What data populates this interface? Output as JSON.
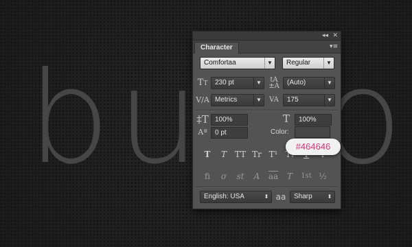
{
  "canvas": {
    "text": "button",
    "text_color": "#464646"
  },
  "panel": {
    "topbar": {
      "collapse_icon": "◂◂",
      "close_icon": "✕"
    },
    "tab_label": "Character",
    "menu_icon": "▾≡",
    "font_family": "Comfortaa",
    "font_style": "Regular",
    "font_size": "230 pt",
    "leading": "(Auto)",
    "kerning": "Metrics",
    "tracking": "175",
    "vertical_scale": "100%",
    "horizontal_scale": "100%",
    "baseline_shift": "0 pt",
    "color_label": "Color:",
    "color_value": "#464646",
    "style_buttons": [
      "T",
      "T",
      "TT",
      "Tr",
      "T¹",
      "T₁",
      "T",
      "T"
    ],
    "opentype_buttons": [
      "fi",
      "σ",
      "st",
      "A",
      "aa",
      "T",
      "1st",
      "½"
    ],
    "language": "English: USA",
    "aa_icon": "aa",
    "antialias": "Sharp"
  },
  "tooltip": {
    "text": "#464646",
    "color": "#e0327d"
  }
}
